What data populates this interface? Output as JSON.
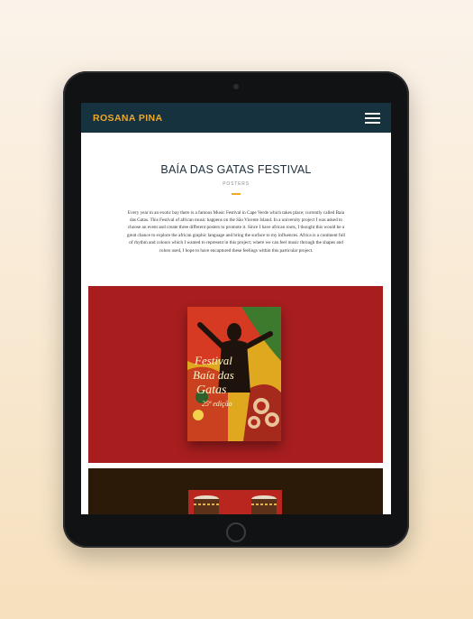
{
  "site": {
    "brand": "ROSANA PINA",
    "menu_icon": "hamburger-menu-icon"
  },
  "project": {
    "title": "BAÍA DAS GATAS FESTIVAL",
    "category": "POSTERS",
    "description": "Every year in an exotic bay there is a famous Music Festival in Cape Verde which takes place; currently called Baía das Gatas. This Festival of african music happens on the São Vicente Island. In a university project I was asked to choose an event and create three different posters to promote it. Since I have african roots, I thought this would be a great chance to explore the african graphic language and bring the surface to my influences. Africa is a continent full of rhythm and colours which I wanted to represent in this project; where we can feel music through the shapes and colors used, I hope to have encaptured these feelings within this particular project."
  },
  "poster": {
    "headline_1": "Festival",
    "headline_2": "Baía das",
    "headline_3": "Gatas",
    "edition": "25ª edição"
  },
  "colors": {
    "nav_bg": "#17323f",
    "accent": "#f1a825",
    "showcase_red": "#a81e1f",
    "showcase_dark": "#2a1a07"
  }
}
